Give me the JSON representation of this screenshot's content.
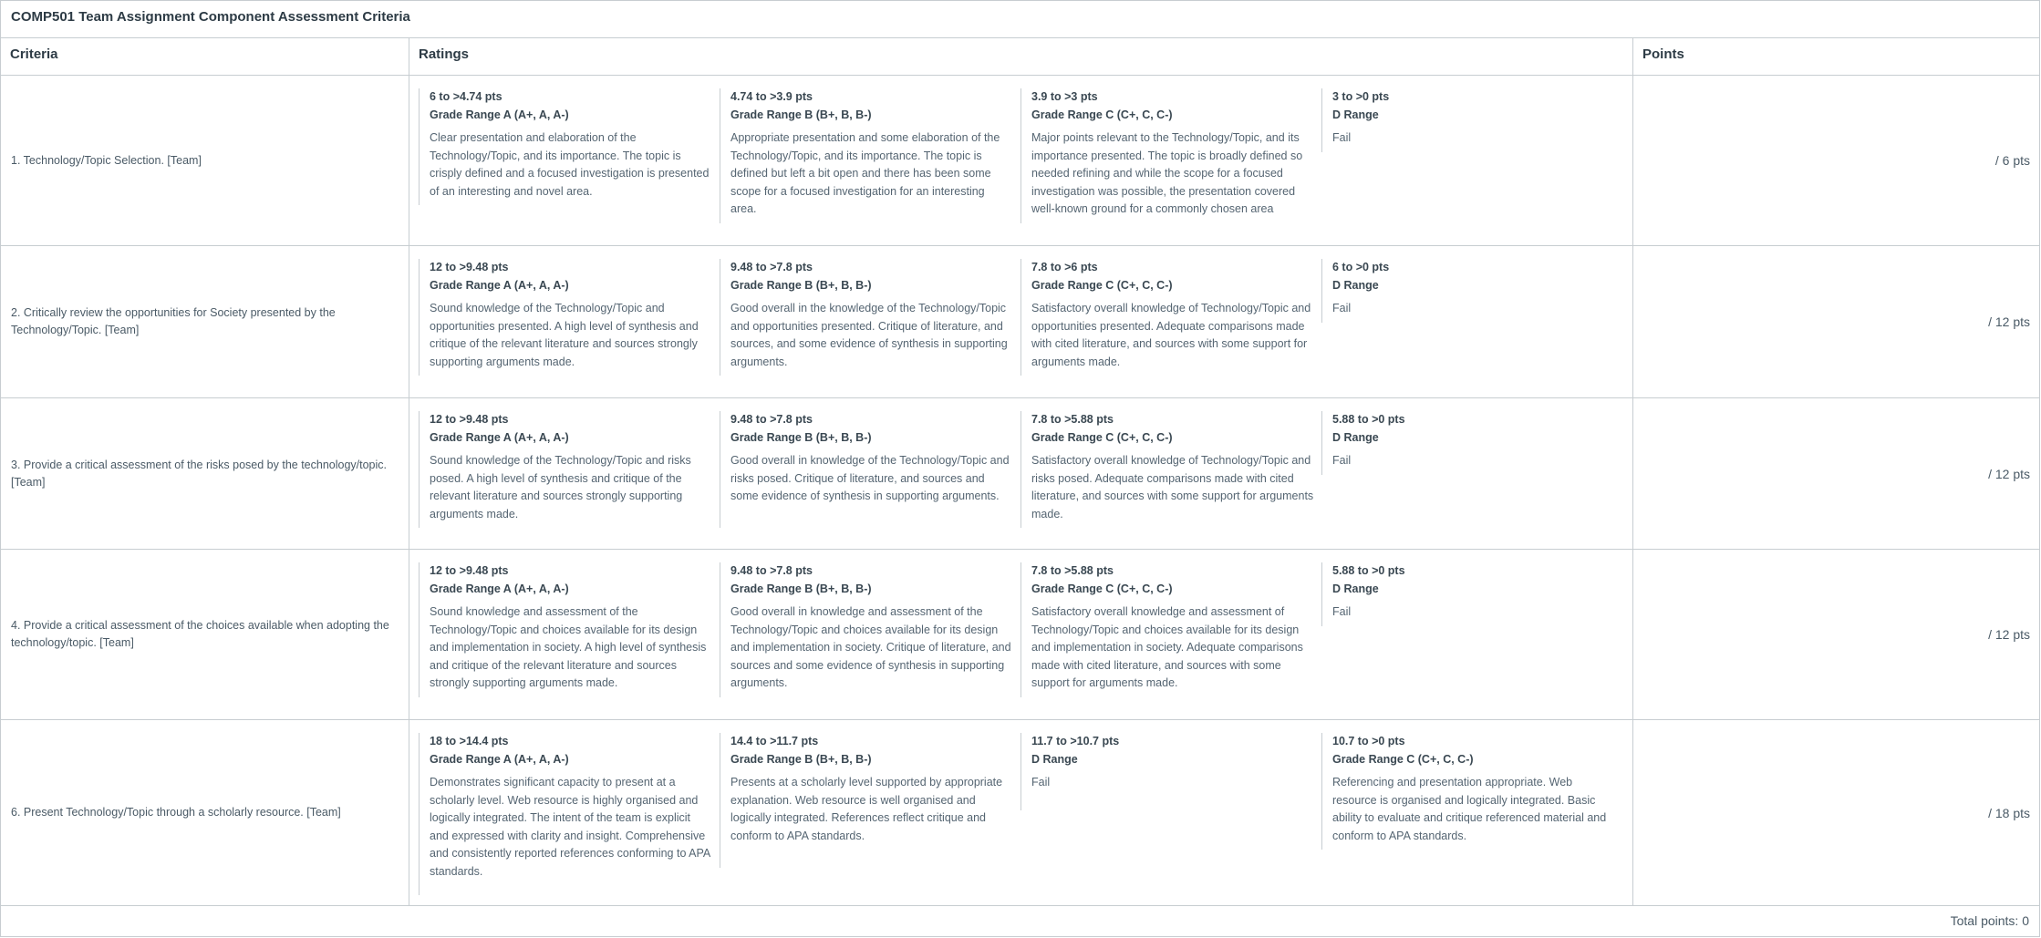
{
  "rubric": {
    "title": "COMP501 Team Assignment Component Assessment Criteria",
    "headers": {
      "criteria": "Criteria",
      "ratings": "Ratings",
      "points": "Points"
    },
    "rows": [
      {
        "criterion": "1. Technology/Topic Selection. [Team]",
        "points": "/ 6 pts",
        "ratings": [
          {
            "pts": "6 to >4.74 pts",
            "title": "Grade Range A (A+, A, A-)",
            "desc": "Clear presentation and elaboration of the Technology/Topic, and its importance. The topic is crisply defined and a focused investigation is presented of an interesting and novel area."
          },
          {
            "pts": "4.74 to >3.9 pts",
            "title": "Grade Range B (B+, B, B-)",
            "desc": "Appropriate presentation and some elaboration of the Technology/Topic, and its importance. The topic is defined but left a bit open and there has been some scope for a focused investigation for an interesting area."
          },
          {
            "pts": "3.9 to >3 pts",
            "title": "Grade Range C (C+, C, C-)",
            "desc": "Major points relevant to the Technology/Topic, and its importance presented. The topic is broadly defined so needed refining and while the scope for a focused investigation was possible, the presentation covered well-known ground for a commonly chosen area"
          },
          {
            "pts": "3 to >0 pts",
            "title": "D Range",
            "desc": "Fail"
          }
        ]
      },
      {
        "criterion": "2. Critically review the opportunities for Society presented by the Technology/Topic. [Team]",
        "points": "/ 12 pts",
        "ratings": [
          {
            "pts": "12 to >9.48 pts",
            "title": "Grade Range A (A+, A, A-)",
            "desc": "Sound knowledge of the Technology/Topic and opportunities presented. A high level of synthesis and critique of the relevant literature and sources strongly supporting arguments made."
          },
          {
            "pts": "9.48 to >7.8 pts",
            "title": "Grade Range B (B+, B, B-)",
            "desc": "Good overall in the knowledge of the Technology/Topic and opportunities presented. Critique of literature, and sources, and some evidence of synthesis in supporting arguments."
          },
          {
            "pts": "7.8 to >6 pts",
            "title": "Grade Range C (C+, C, C-)",
            "desc": "Satisfactory overall knowledge of Technology/Topic and opportunities presented. Adequate comparisons made with cited literature, and sources with some support for arguments made."
          },
          {
            "pts": "6 to >0 pts",
            "title": "D Range",
            "desc": "Fail"
          }
        ]
      },
      {
        "criterion": "3. Provide a critical assessment of the risks posed by the technology/topic. [Team]",
        "points": "/ 12 pts",
        "ratings": [
          {
            "pts": "12 to >9.48 pts",
            "title": "Grade Range A (A+, A, A-)",
            "desc": "Sound knowledge of the Technology/Topic and risks posed. A high level of synthesis and critique of the relevant literature and sources strongly supporting arguments made."
          },
          {
            "pts": "9.48 to >7.8 pts",
            "title": "Grade Range B (B+, B, B-)",
            "desc": "Good overall in knowledge of the Technology/Topic and risks posed. Critique of literature, and sources and some evidence of synthesis in supporting arguments."
          },
          {
            "pts": "7.8 to >5.88 pts",
            "title": "Grade Range C (C+, C, C-)",
            "desc": "Satisfactory overall knowledge of Technology/Topic and risks posed. Adequate comparisons made with cited literature, and sources with some support for arguments made."
          },
          {
            "pts": "5.88 to >0 pts",
            "title": "D Range",
            "desc": "Fail"
          }
        ]
      },
      {
        "criterion": "4. Provide a critical assessment of the choices available when adopting the technology/topic. [Team]",
        "points": "/ 12 pts",
        "ratings": [
          {
            "pts": "12 to >9.48 pts",
            "title": "Grade Range A (A+, A, A-)",
            "desc": "Sound knowledge and assessment of the Technology/Topic and choices available for its design and implementation in society. A high level of synthesis and critique of the relevant literature and sources strongly supporting arguments made."
          },
          {
            "pts": "9.48 to >7.8 pts",
            "title": "Grade Range B (B+, B, B-)",
            "desc": "Good overall in knowledge and assessment of the Technology/Topic and choices available for its design and implementation in society. Critique of literature, and sources and some evidence of synthesis in supporting arguments."
          },
          {
            "pts": "7.8 to >5.88 pts",
            "title": "Grade Range C (C+, C, C-)",
            "desc": "Satisfactory overall knowledge and assessment of Technology/Topic and choices available for its design and implementation in society. Adequate comparisons made with cited literature, and sources with some support for arguments made."
          },
          {
            "pts": "5.88 to >0 pts",
            "title": "D Range",
            "desc": "Fail"
          }
        ]
      },
      {
        "criterion": "6. Present Technology/Topic through a scholarly resource. [Team]",
        "points": "/ 18 pts",
        "ratings": [
          {
            "pts": "18 to >14.4 pts",
            "title": "Grade Range A (A+, A, A-)",
            "desc": "Demonstrates significant capacity to present at a scholarly level. Web resource is highly organised and logically integrated. The intent of the team is explicit and expressed with clarity and insight. Comprehensive and consistently reported references conforming to APA standards."
          },
          {
            "pts": "14.4 to >11.7 pts",
            "title": "Grade Range B (B+, B, B-)",
            "desc": "Presents at a scholarly level supported by appropriate explanation. Web resource is well organised and logically integrated. References reflect critique and conform to APA standards."
          },
          {
            "pts": "11.7 to >10.7 pts",
            "title": "D Range",
            "desc": "Fail"
          },
          {
            "pts": "10.7 to >0 pts",
            "title": "Grade Range C (C+, C, C-)",
            "desc": "Referencing and presentation appropriate. Web resource is organised and logically integrated. Basic ability to evaluate and critique referenced material and conform to APA standards."
          }
        ]
      }
    ],
    "total": "Total points: 0"
  }
}
